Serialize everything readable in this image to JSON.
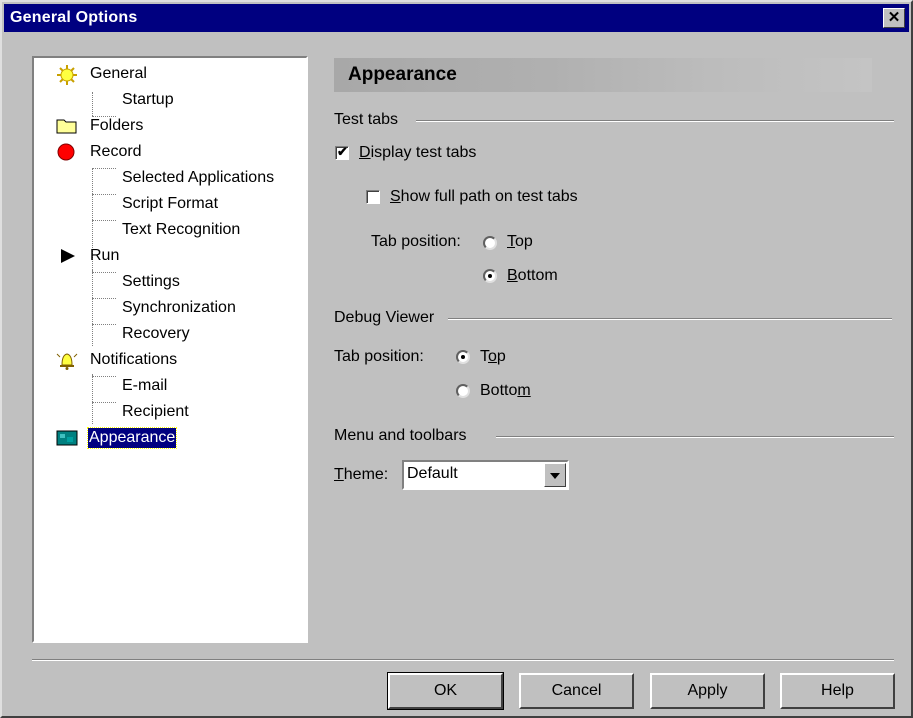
{
  "window": {
    "title": "General Options",
    "close_glyph": "✕"
  },
  "tree": {
    "items": [
      {
        "label": "General",
        "icon": "sun-icon"
      },
      {
        "label": "Startup"
      },
      {
        "label": "Folders",
        "icon": "folder-icon"
      },
      {
        "label": "Record",
        "icon": "record-icon"
      },
      {
        "label": "Selected Applications"
      },
      {
        "label": "Script Format"
      },
      {
        "label": "Text Recognition"
      },
      {
        "label": "Run",
        "icon": "play-icon"
      },
      {
        "label": "Settings"
      },
      {
        "label": "Synchronization"
      },
      {
        "label": "Recovery"
      },
      {
        "label": "Notifications",
        "icon": "bell-icon"
      },
      {
        "label": "E-mail"
      },
      {
        "label": "Recipient"
      },
      {
        "label": "Appearance",
        "icon": "appearance-icon",
        "selected": true
      }
    ]
  },
  "panel": {
    "heading": "Appearance",
    "test_tabs": {
      "group_label": "Test tabs",
      "display_test_tabs": {
        "label_u": "D",
        "label_rest": "isplay test tabs",
        "checked": true
      },
      "show_full_path": {
        "label_u": "S",
        "label_rest": "how full path on test tabs",
        "checked": false
      },
      "tab_position_label": "Tab position:",
      "top": {
        "label_u": "T",
        "label_rest": "op",
        "selected": false
      },
      "bottom": {
        "label_u": "B",
        "label_rest": "ottom",
        "selected": true
      }
    },
    "debug_viewer": {
      "group_label": "Debug Viewer",
      "tab_position_label": "Tab position:",
      "top": {
        "label_pre": "T",
        "label_u": "o",
        "label_rest": "p",
        "selected": true
      },
      "bottom": {
        "label_pre": "Botto",
        "label_u": "m",
        "label_rest": "",
        "selected": false
      }
    },
    "menu_toolbars": {
      "group_label": "Menu and toolbars",
      "theme_label_u": "T",
      "theme_label_rest": "heme:",
      "theme_value": "Default"
    }
  },
  "buttons": {
    "ok": "OK",
    "cancel": "Cancel",
    "apply": "Apply",
    "help": "Help"
  },
  "colors": {
    "titlebar": "#000080",
    "dialog_bg": "#c0c0c0",
    "selection": "#000080"
  }
}
